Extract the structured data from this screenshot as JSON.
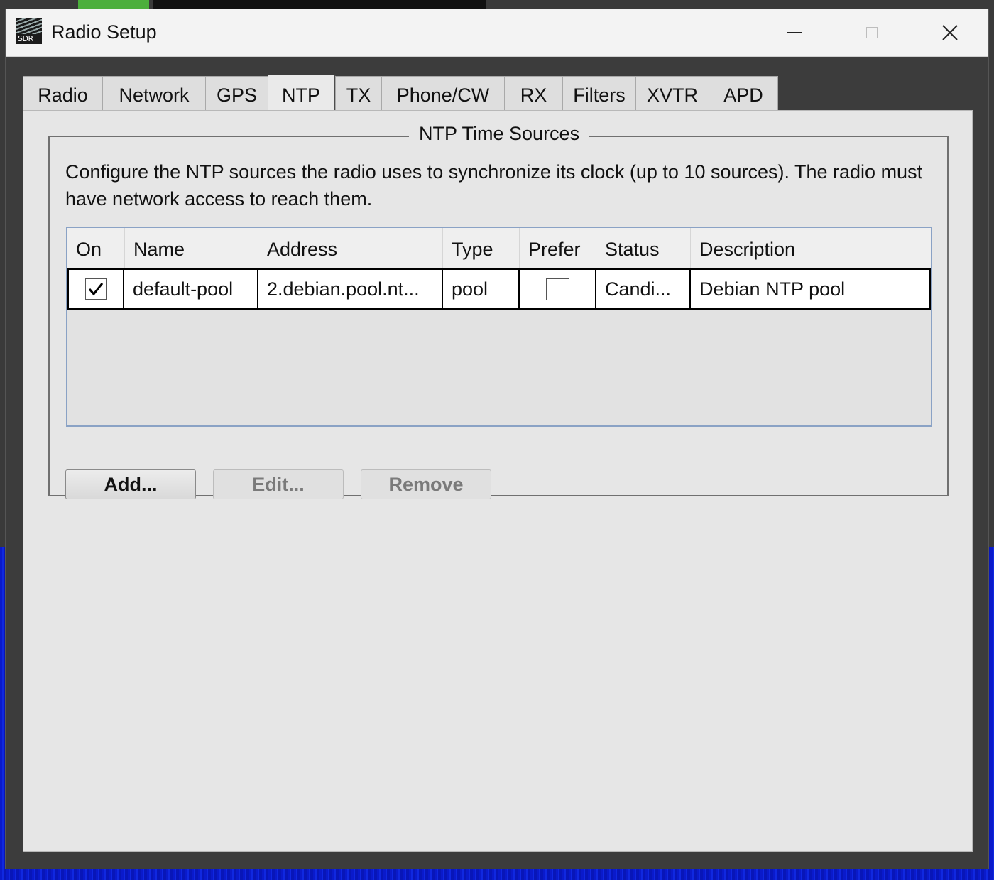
{
  "window": {
    "title": "Radio Setup",
    "icon_label": "SDR"
  },
  "tabs": [
    {
      "label": "Radio"
    },
    {
      "label": "Network"
    },
    {
      "label": "GPS"
    },
    {
      "label": "NTP",
      "active": true
    },
    {
      "label": "TX"
    },
    {
      "label": "Phone/CW"
    },
    {
      "label": "RX"
    },
    {
      "label": "Filters"
    },
    {
      "label": "XVTR"
    },
    {
      "label": "APD"
    }
  ],
  "ntp": {
    "group_title": "NTP Time Sources",
    "description": "Configure the NTP sources the radio uses to synchronize its clock (up to 10 sources). The radio must have network access to reach them.",
    "columns": {
      "on": "On",
      "name": "Name",
      "address": "Address",
      "type": "Type",
      "prefer": "Prefer",
      "status": "Status",
      "description": "Description"
    },
    "rows": [
      {
        "on": true,
        "name": "default-pool",
        "address": "2.debian.pool.nt...",
        "type": "pool",
        "prefer": false,
        "status": "Candi...",
        "description": "Debian NTP pool"
      }
    ],
    "buttons": {
      "add": "Add...",
      "edit": "Edit...",
      "remove": "Remove"
    }
  },
  "icons": {
    "minimize": "minimize-icon",
    "maximize": "maximize-icon",
    "close": "close-icon",
    "check": "checkmark-icon"
  }
}
